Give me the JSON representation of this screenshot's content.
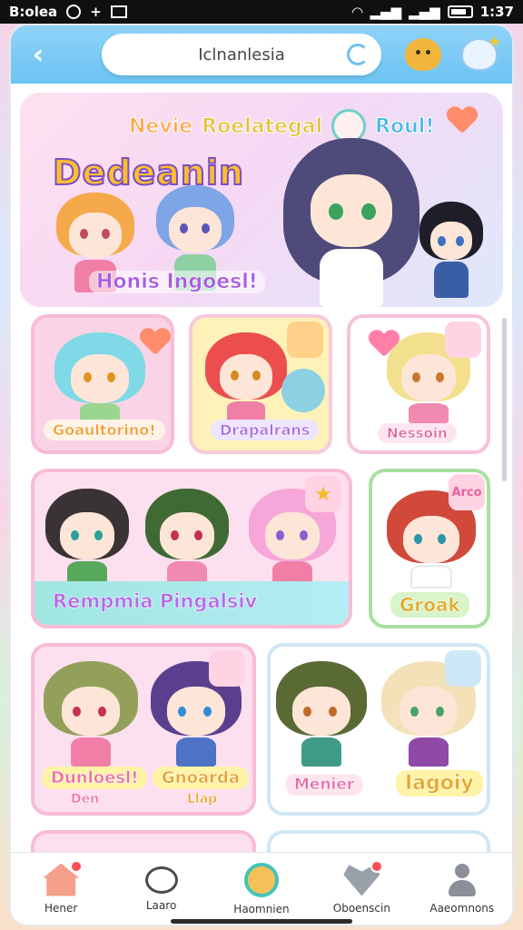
{
  "status_bar": {
    "left_text": "B:olea",
    "time": "1:37"
  },
  "header": {
    "search_value": "Iclnanlesia"
  },
  "hero": {
    "tags": [
      "Nevie",
      "Roelategal",
      "Roul!"
    ],
    "title": "Dedeanin",
    "subtitle": "Honis Ingoesl!"
  },
  "cards": [
    {
      "label": "Goaultorino!"
    },
    {
      "label": "Drapalrans"
    },
    {
      "label": "Nessoin"
    },
    {
      "label": "Rempmia Pingalsiv",
      "badge": "★"
    },
    {
      "label": "Groak",
      "badge": "Arco"
    },
    {
      "label_a": "Dunloesl!",
      "label_a2": "Den",
      "label_b": "Gnoarda",
      "label_b2": "Llap"
    },
    {
      "label_a": "Menier",
      "label_b": "Iagoiy"
    }
  ],
  "tabbar": {
    "items": [
      {
        "label": "Hener",
        "icon": "home-icon"
      },
      {
        "label": "Laaro",
        "icon": "chat-icon"
      },
      {
        "label": "Haomnien",
        "icon": "discover-icon"
      },
      {
        "label": "Oboenscin",
        "icon": "heart-icon"
      },
      {
        "label": "Aaeomnons",
        "icon": "person-icon"
      }
    ]
  },
  "colors": {
    "accent": "#6cc3f3",
    "pink": "#ff7fa7",
    "green": "#8fd88c"
  }
}
